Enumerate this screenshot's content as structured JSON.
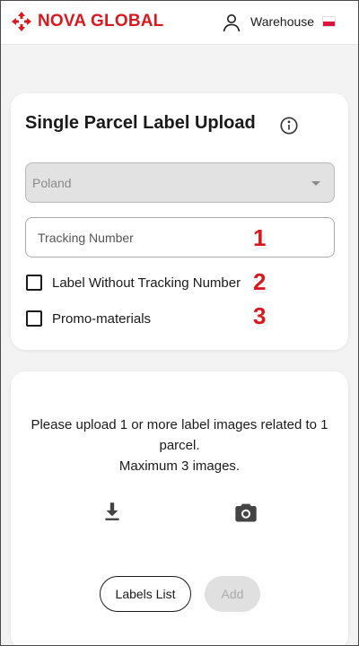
{
  "header": {
    "brand": "NOVA GLOBAL",
    "user_label": "Warehouse",
    "flag": "pl-flag-icon",
    "brand_color": "#d8191f"
  },
  "form_card": {
    "title": "Single Parcel Label Upload",
    "country_select": {
      "value": "Poland"
    },
    "tracking_input": {
      "placeholder": "Tracking Number",
      "value": ""
    },
    "checkboxes": [
      {
        "label": "Label Without Tracking Number",
        "checked": false
      },
      {
        "label": "Promo-materials",
        "checked": false
      }
    ],
    "markers": [
      "1",
      "2",
      "3"
    ]
  },
  "upload_card": {
    "instructions": [
      "Please upload 1 or more label images related to 1 parcel.",
      "Maximum 3 images."
    ],
    "buttons": {
      "labels_list": "Labels List",
      "add": "Add"
    }
  }
}
